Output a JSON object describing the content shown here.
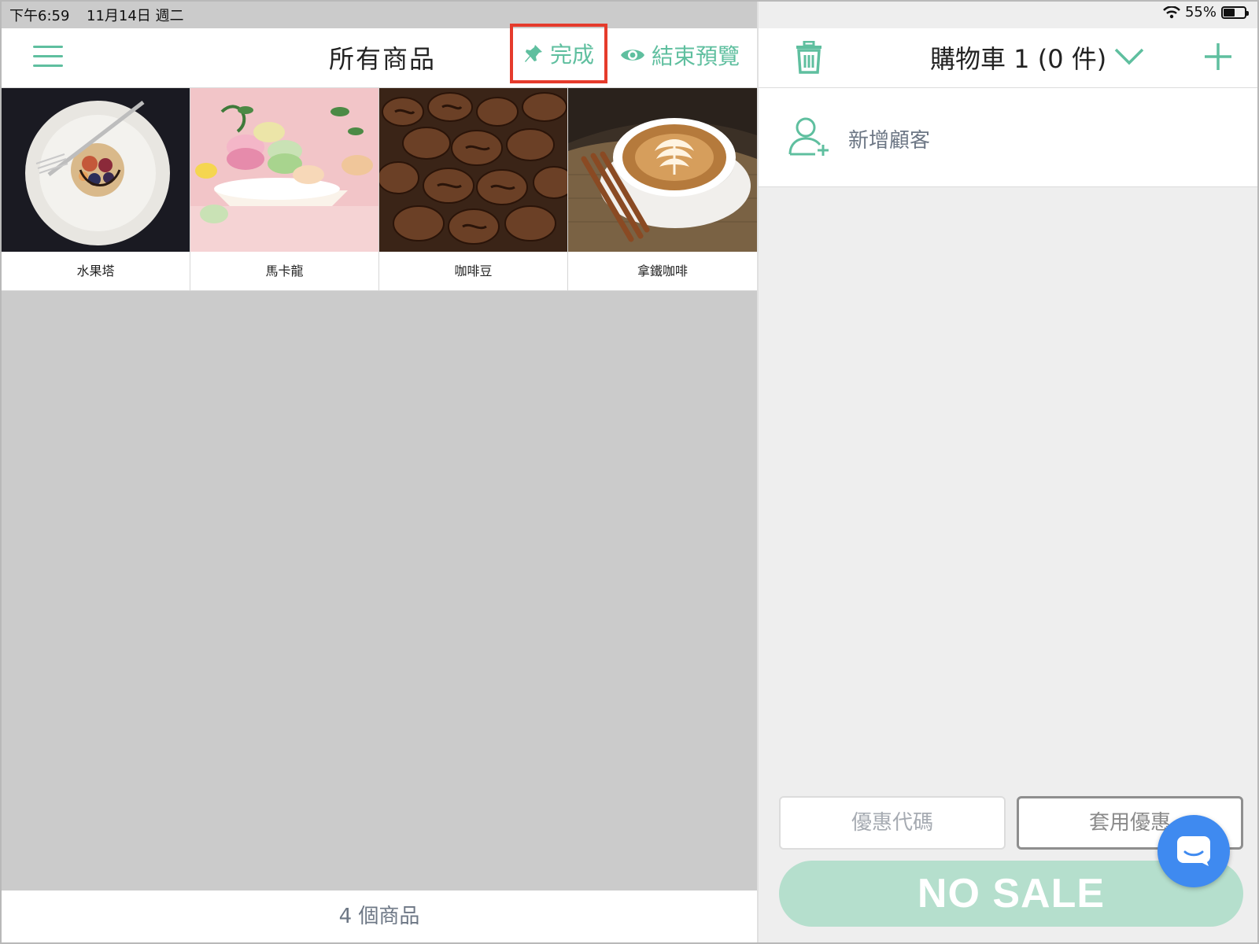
{
  "status_bar": {
    "time": "下午6:59",
    "date": "11月14日 週二",
    "battery": "55%",
    "battery_level": 0.55
  },
  "left_header": {
    "title": "所有商品",
    "done_label": "完成",
    "preview_label": "結束預覽"
  },
  "products": [
    {
      "name": "水果塔",
      "image": "fruit-tart"
    },
    {
      "name": "馬卡龍",
      "image": "macarons"
    },
    {
      "name": "咖啡豆",
      "image": "coffee-beans"
    },
    {
      "name": "拿鐵咖啡",
      "image": "latte"
    }
  ],
  "left_footer": {
    "count_label": "4 個商品"
  },
  "cart": {
    "title": "購物車 1 (0 件)",
    "add_customer": "新增顧客",
    "promo_placeholder": "優惠代碼",
    "apply_label": "套用優惠",
    "no_sale": "NO SALE"
  },
  "colors": {
    "accent": "#5fbf9f",
    "highlight": "#e53b2c",
    "no_sale_bg": "#b5dfcd",
    "chat": "#3f8af0"
  }
}
